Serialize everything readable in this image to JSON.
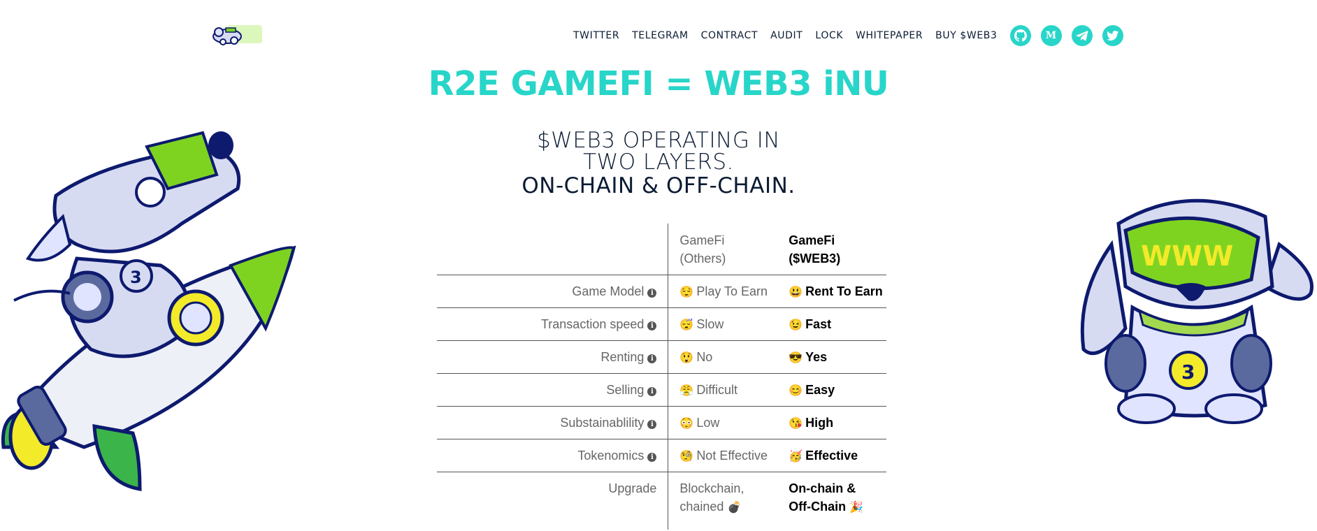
{
  "header": {
    "nav": [
      "TWITTER",
      "TELEGRAM",
      "CONTRACT",
      "AUDIT",
      "LOCK",
      "WHITEPAPER",
      "BUY $WEB3"
    ],
    "social": [
      {
        "icon": "github-icon"
      },
      {
        "icon": "medium-icon",
        "glyph": "M"
      },
      {
        "icon": "telegram-icon"
      },
      {
        "icon": "twitter-icon"
      }
    ]
  },
  "hero": {
    "title": "R2E GAMEFI = WEB3 iNU",
    "line1": "$WEB3 OPERATING IN",
    "line2": "TWO LAYERS.",
    "line3": "ON-CHAIN & OFF-CHAIN."
  },
  "table": {
    "head": {
      "others_1": "GameFi",
      "others_2": "(Others)",
      "web3_1": "GameFi",
      "web3_2": "($WEB3)"
    },
    "rows": [
      {
        "label": "Game Model",
        "others_emoji": "😌",
        "others": "Play To Earn",
        "web3_emoji": "😃",
        "web3": "Rent To Earn"
      },
      {
        "label": "Transaction speed",
        "others_emoji": "😴",
        "others": "Slow",
        "web3_emoji": "😉",
        "web3": "Fast"
      },
      {
        "label": "Renting",
        "others_emoji": "😲",
        "others": "No",
        "web3_emoji": "😎",
        "web3": "Yes"
      },
      {
        "label": "Selling",
        "others_emoji": "😤",
        "others": "Difficult",
        "web3_emoji": "😊",
        "web3": "Easy"
      },
      {
        "label": "Substainablility",
        "others_emoji": "😳",
        "others": "Low",
        "web3_emoji": "😘",
        "web3": "High"
      },
      {
        "label": "Tokenomics",
        "others_emoji": "🧐",
        "others": "Not Effective",
        "web3_emoji": "🥳",
        "web3": "Effective"
      }
    ],
    "last": {
      "label": "Upgrade",
      "others_1": "Blockchain,",
      "others_2": "chained",
      "others_emoji": "💣",
      "web3_1": "On-chain &",
      "web3_2": "Off-Chain",
      "web3_emoji": "🎉"
    }
  },
  "colors": {
    "accent": "#28d5c9",
    "text": "#0b1b33",
    "mascot_green": "#7ed321",
    "mascot_navy": "#0d1a6e"
  }
}
